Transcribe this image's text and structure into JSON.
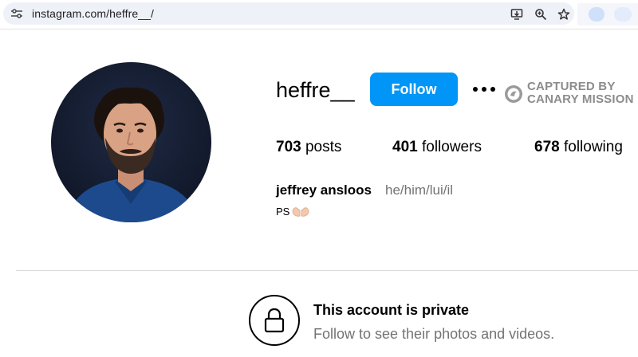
{
  "browser": {
    "url": "instagram.com/heffre__/",
    "icons": [
      "tune-icon",
      "install-icon",
      "zoom-icon",
      "star-icon"
    ]
  },
  "profile": {
    "username": "heffre__",
    "follow_label": "Follow",
    "watermark_line1": "CAPTURED BY",
    "watermark_line2": "CANARY MISSION",
    "stats": {
      "posts_count": "703",
      "posts_label": "posts",
      "followers_count": "401",
      "followers_label": "followers",
      "following_count": "678",
      "following_label": "following"
    },
    "full_name": "jeffrey ansloos",
    "pronouns": "he/him/lui/il",
    "bio": "PS"
  },
  "private_notice": {
    "title": "This account is private",
    "subtitle": "Follow to see their photos and videos."
  },
  "colors": {
    "follow_button": "#0095f6",
    "secondary_text": "#737373",
    "watermark": "#8c8c8c"
  }
}
